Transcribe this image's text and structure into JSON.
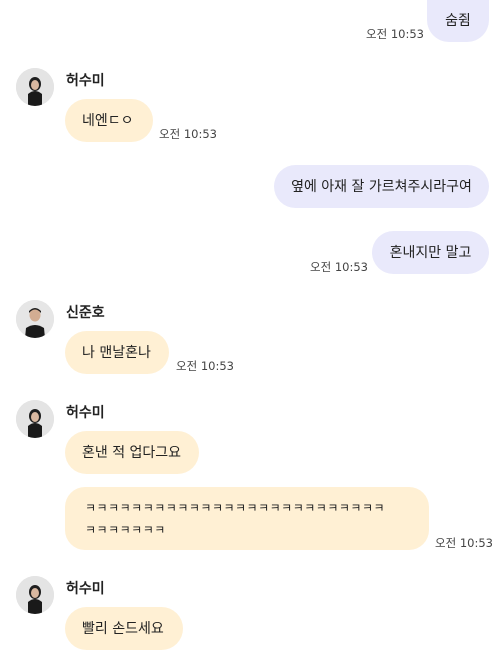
{
  "messages": [
    {
      "type": "mine",
      "text": "숨쥠",
      "time": "오전 10:53"
    },
    {
      "type": "theirs",
      "sender": "허수미",
      "text": "네엔ㄷㅇ",
      "time": "오전 10:53"
    },
    {
      "type": "mine",
      "text": "옆에 아재 잘 가르쳐주시라구여",
      "time": ""
    },
    {
      "type": "mine",
      "text": "혼내지만 말고",
      "time": "오전 10:53"
    },
    {
      "type": "theirs",
      "sender": "신준호",
      "text": "나 맨날혼나",
      "time": "오전 10:53"
    },
    {
      "type": "theirs",
      "sender": "허수미",
      "text": "혼낸 적 업다그요",
      "time": ""
    },
    {
      "type": "theirs",
      "sender": "",
      "text_line1": "ㅋㅋㅋㅋㅋㅋㅋㅋㅋㅋㅋㅋㅋㅋㅋㅋㅋㅋㅋㅋㅋㅋㅋㅋㅋㅋ",
      "text_line2": "ㅋㅋㅋㅋㅋㅋㅋ",
      "time": "오전 10:53"
    },
    {
      "type": "theirs",
      "sender": "허수미",
      "text": "빨리 손드세요",
      "time": ""
    }
  ],
  "colors": {
    "mine_bubble": "#e9e9fb",
    "theirs_bubble": "#fff0d4"
  }
}
